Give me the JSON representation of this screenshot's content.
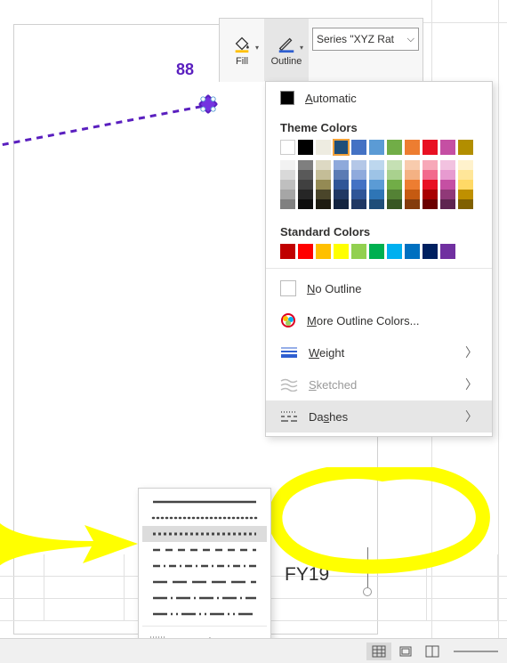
{
  "minitoolbar": {
    "fill_label": "Fill",
    "outline_label": "Outline",
    "series_box": "Series \"XYZ Rat"
  },
  "outline_menu": {
    "automatic": "Automatic",
    "theme_header": "Theme Colors",
    "standard_header": "Standard Colors",
    "no_outline": "No Outline",
    "more_colors": "More Outline Colors...",
    "weight": "Weight",
    "sketched": "Sketched",
    "dashes": "Dashes",
    "theme_colors_row": [
      "#ffffff",
      "#000000",
      "#eeece1",
      "#1f4e79",
      "#4472c4",
      "#5b9bd5",
      "#71ad47",
      "#ed7d31",
      "#e81123",
      "#c54fa3",
      "#b28e00"
    ],
    "standard_colors_row": [
      "#c00000",
      "#ff0000",
      "#ffc000",
      "#ffff00",
      "#92d050",
      "#00b050",
      "#00b0f0",
      "#0070c0",
      "#002060",
      "#7030a0"
    ],
    "selected_theme_index": 3
  },
  "dash_menu": {
    "options": [
      "solid",
      "round-dot",
      "square-dot",
      "dash",
      "dash-dot",
      "long-dash",
      "long-dash-dot",
      "long-dash-dot-dot"
    ],
    "selected": "square-dot",
    "more_lines": "More Lines..."
  },
  "chart_context": {
    "data_label": "88",
    "axis_label": "FY19"
  },
  "chart_data": {
    "type": "line",
    "series": [
      {
        "name": "XYZ Rat",
        "values": [
          88
        ],
        "style": "dashed",
        "color": "#5a1fbf"
      }
    ],
    "categories": [
      "FY19"
    ],
    "title": "",
    "xlabel": "",
    "ylabel": ""
  },
  "statusbar": {
    "views": [
      "normal",
      "page-layout",
      "page-break"
    ],
    "active_view": "normal"
  }
}
